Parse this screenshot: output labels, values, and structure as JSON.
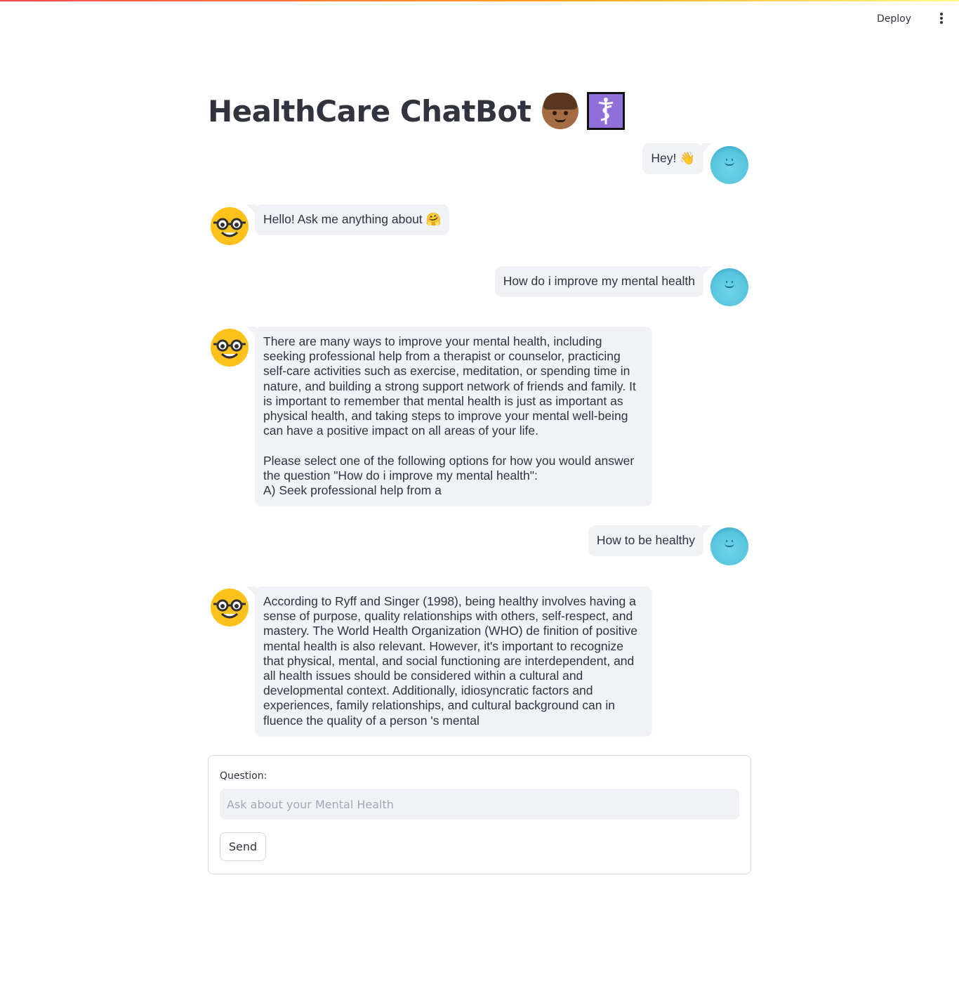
{
  "header": {
    "deploy_label": "Deploy",
    "menu_icon": "kebab-menu-icon"
  },
  "page": {
    "title": "HealthCare ChatBot",
    "title_emojis": [
      "man-medium-skin-tone-emoji",
      "medical-symbol-emoji"
    ]
  },
  "chat": {
    "messages": [
      {
        "role": "user",
        "text": "Hey! 👋",
        "avatar": "user-avatar-icon"
      },
      {
        "role": "bot",
        "text": "Hello! Ask me anything about 🤗",
        "avatar": "nerd-face-avatar-icon"
      },
      {
        "role": "user",
        "text": "How do i improve my mental health",
        "avatar": "user-avatar-icon"
      },
      {
        "role": "bot",
        "text": "There are many ways to improve your mental health, including\nseeking professional help from a therapist or counselor, practicing\nself-care activities such as exercise, meditation, or spending time in\nnature, and building a strong support network of friends and family. It\nis important to remember that mental health is just as important as\nphysical health, and taking steps to improve your mental well-being\ncan have a positive impact on all areas of your life.\n\nPlease select one of the following options for how you would answer\nthe question \"How do i improve my mental health\":\nA) Seek professional help from a",
        "avatar": "nerd-face-avatar-icon"
      },
      {
        "role": "user",
        "text": "How to be healthy",
        "avatar": "user-avatar-icon"
      },
      {
        "role": "bot",
        "text": "According to Ryff and Singer (1998), being healthy involves having a\nsense of purpose, quality relationships with others, self-respect, and\nmastery. The World Health Organization (WHO) de finition of positive\nmental health is also relevant. However, it's important to recognize\nthat physical, mental, and social functioning are interdependent, and\nall health issues should be considered within a cultural and\ndevelopmental context. Additionally, idiosyncratic factors and\nexperiences, family relationships, and cultural background can in\nfluence the quality of a person 's mental",
        "avatar": "nerd-face-avatar-icon"
      }
    ]
  },
  "form": {
    "label": "Question:",
    "input_value": "",
    "input_placeholder": "Ask about your Mental Health",
    "send_label": "Send"
  },
  "colors": {
    "bubble_bg": "#f0f2f6",
    "text": "#31333f",
    "user_avatar": "#58c6df",
    "bot_avatar": "#fcc21b"
  }
}
